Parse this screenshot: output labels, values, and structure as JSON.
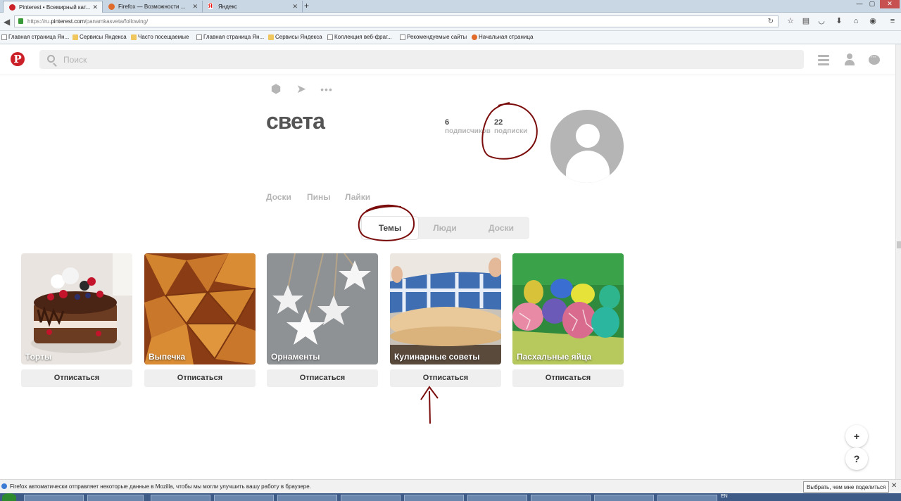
{
  "browser": {
    "tabs": [
      {
        "title": "Pinterest • Всемирный кат...",
        "active": true
      },
      {
        "title": "Firefox — Возможности ...",
        "active": false
      },
      {
        "title": "Яндекс",
        "active": false
      }
    ],
    "new_tab_label": "+",
    "url_prefix": "https://ru.",
    "url_host": "pinterest.com",
    "url_path": "/panamkasveta/following/",
    "bookmarks": [
      {
        "label": "Главная страница Ян...",
        "icon": "page-icon"
      },
      {
        "label": "Сервисы Яндекса",
        "icon": "folder-icon"
      },
      {
        "label": "Часто посещаемые",
        "icon": "folder-icon"
      },
      {
        "label": "Главная страница Ян...",
        "icon": "page-icon"
      },
      {
        "label": "Сервисы Яндекса",
        "icon": "folder-icon"
      },
      {
        "label": "Коллекция веб-фраг...",
        "icon": "page-icon"
      },
      {
        "label": "Рекомендуемые сайты",
        "icon": "page-icon"
      },
      {
        "label": "Начальная страница",
        "icon": "firefox-icon"
      }
    ]
  },
  "header": {
    "logo_letter": "P",
    "search_placeholder": "Поиск"
  },
  "profile": {
    "name": "света",
    "followers_count": "6",
    "followers_label": "подписчиков",
    "following_count": "22",
    "following_label": "подписки"
  },
  "subnav": [
    "Доски",
    "Пины",
    "Лайки"
  ],
  "segments": [
    {
      "label": "Темы",
      "active": true
    },
    {
      "label": "Люди",
      "active": false
    },
    {
      "label": "Доски",
      "active": false
    }
  ],
  "topics": [
    {
      "title": "Торты",
      "button": "Отписаться"
    },
    {
      "title": "Выпечка",
      "button": "Отписаться"
    },
    {
      "title": "Орнаменты",
      "button": "Отписаться"
    },
    {
      "title": "Кулинарные советы",
      "button": "Отписаться"
    },
    {
      "title": "Пасхальные яйца",
      "button": "Отписаться"
    }
  ],
  "float_buttons": {
    "add": "+",
    "help": "?"
  },
  "notification": {
    "text": "Firefox автоматически отправляет некоторые данные в Mozilla, чтобы мы могли улучшить вашу работу в браузере.",
    "button": "Выбрать, чем мне поделиться",
    "close": "✕"
  },
  "taskbar": {
    "lang": "EN"
  },
  "colors": {
    "pinterest_red": "#cb2027",
    "annotation_red": "#7a0c0c"
  }
}
